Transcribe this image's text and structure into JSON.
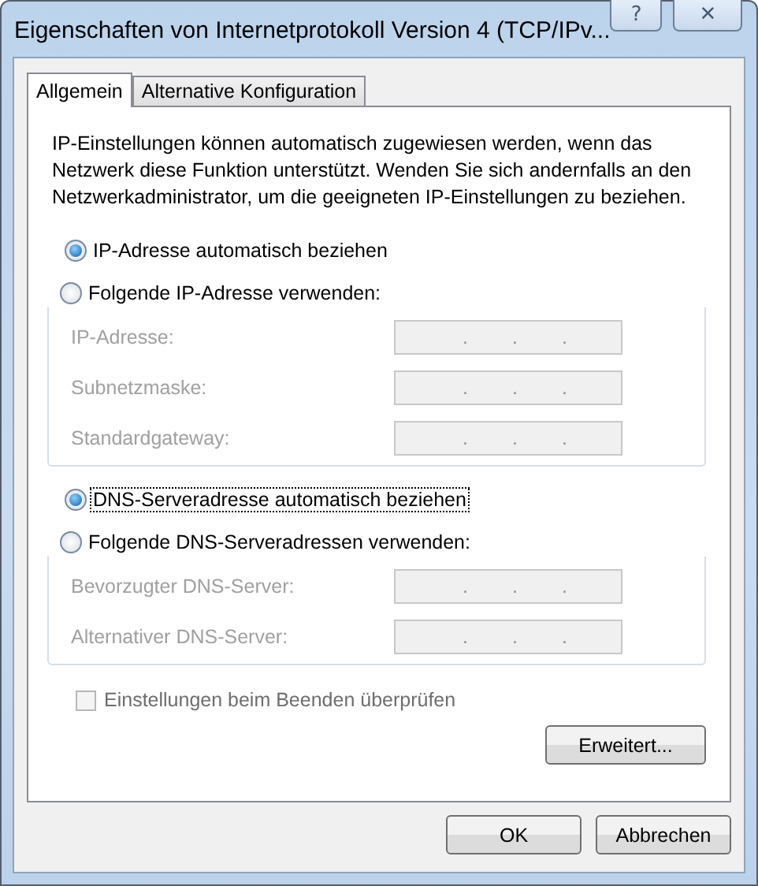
{
  "window": {
    "title": "Eigenschaften von Internetprotokoll Version 4 (TCP/IPv...",
    "help": "?",
    "close": "✕"
  },
  "tabs": [
    {
      "label": "Allgemein",
      "selected": true
    },
    {
      "label": "Alternative Konfiguration",
      "selected": false
    }
  ],
  "intro": "IP-Einstellungen können automatisch zugewiesen werden, wenn das Netzwerk diese Funktion unterstützt. Wenden Sie sich andernfalls an den Netzwerkadministrator, um die geeigneten IP-Einstellungen zu beziehen.",
  "sections": [
    {
      "auto": {
        "label": "IP-Adresse automatisch beziehen",
        "selected": true,
        "focused": false
      },
      "manual": {
        "label": "Folgende IP-Adresse verwenden:",
        "selected": false
      },
      "fields": [
        {
          "label": "IP-Adresse:",
          "separators": [
            ".",
            ".",
            "."
          ],
          "disabled": true
        },
        {
          "label": "Subnetzmaske:",
          "separators": [
            ".",
            ".",
            "."
          ],
          "disabled": true
        },
        {
          "label": "Standardgateway:",
          "separators": [
            ".",
            ".",
            "."
          ],
          "disabled": true
        }
      ]
    },
    {
      "auto": {
        "label": "DNS-Serveradresse automatisch beziehen",
        "selected": true,
        "focused": true
      },
      "manual": {
        "label": "Folgende DNS-Serveradressen verwenden:",
        "selected": false
      },
      "fields": [
        {
          "label": "Bevorzugter DNS-Server:",
          "separators": [
            ".",
            ".",
            "."
          ],
          "disabled": true
        },
        {
          "label": "Alternativer DNS-Server:",
          "separators": [
            ".",
            ".",
            "."
          ],
          "disabled": true
        }
      ]
    }
  ],
  "validate": {
    "label": "Einstellungen beim Beenden überprüfen",
    "checked": false,
    "disabled": true
  },
  "advanced_button": "Erweitert...",
  "buttons": [
    "OK",
    "Abbrechen"
  ]
}
